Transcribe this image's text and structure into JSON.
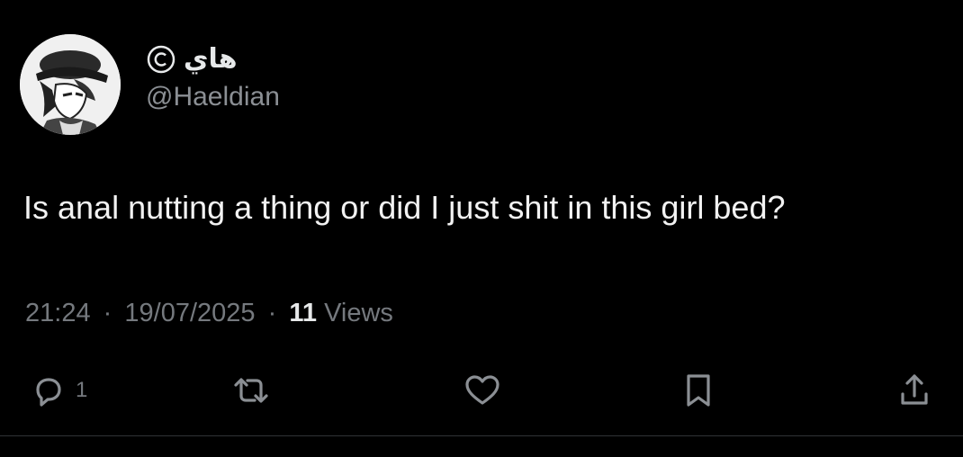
{
  "author": {
    "display_name": "هاي",
    "handle": "@Haeldian",
    "avatar_icon": "anime-character-avatar",
    "badge_icon": "copyright-icon"
  },
  "tweet": {
    "text": "Is anal nutting a thing or did I just shit in this girl bed?",
    "time": "21:24",
    "date": "19/07/2025",
    "separator": "·",
    "views_count": "11",
    "views_label": "Views"
  },
  "actions": {
    "reply_count": "1",
    "icons": [
      "reply-icon",
      "retweet-icon",
      "like-icon",
      "bookmark-icon",
      "share-icon"
    ]
  },
  "colors": {
    "background": "#000000",
    "primary_text": "#e7e9ea",
    "secondary_text": "#75797e"
  }
}
